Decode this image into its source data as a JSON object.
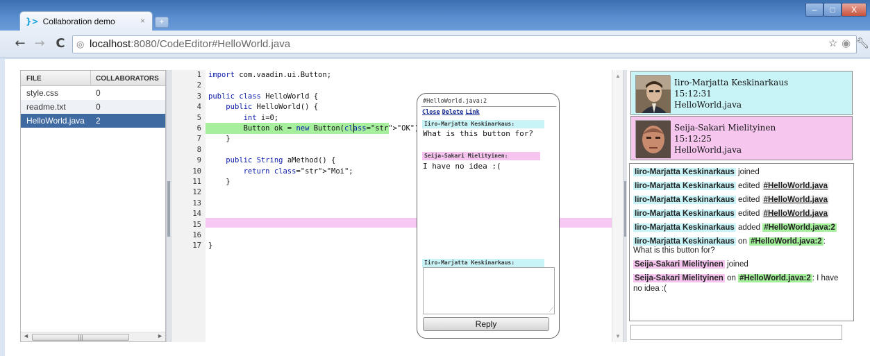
{
  "browser": {
    "tab_title": "Collaboration demo",
    "tab_close": "×",
    "favicon": "}>",
    "new_tab": "+",
    "window_minimize": "–",
    "window_maximize": "□",
    "window_close": "X",
    "url_host": "localhost",
    "url_path": ":8080/CodeEditor#HelloWorld.java"
  },
  "files": {
    "headers": [
      "FILE",
      "COLLABORATORS"
    ],
    "rows": [
      {
        "name": "style.css",
        "count": "0"
      },
      {
        "name": "readme.txt",
        "count": "0"
      },
      {
        "name": "HelloWorld.java",
        "count": "2"
      }
    ],
    "selected_index": 2
  },
  "editor": {
    "lines": [
      "import com.vaadin.ui.Button;",
      "",
      "public class HelloWorld {",
      "    public HelloWorld() {",
      "        int i=0;",
      "        Button ok = new Button(\"OK\");",
      "    }",
      "",
      "    public String aMethod() {",
      "        return \"Moi\";",
      "    }",
      "",
      "",
      "",
      "",
      "",
      "}"
    ],
    "line_numbers": [
      "1",
      "2",
      "3",
      "4",
      "5",
      "6",
      "7",
      "8",
      "9",
      "10",
      "11",
      "12",
      "13",
      "14",
      "15",
      "16",
      "17"
    ],
    "highlight_colors": {
      "own": "#a6ef9d",
      "other": "#f7c9f2"
    }
  },
  "comment_popup": {
    "title": "#HelloWorld.java:2",
    "links": [
      "Close",
      "Delete",
      "Link"
    ],
    "thread": [
      {
        "author": "Iiro-Marjatta Keskinarkaus:",
        "message": "What is this button for?",
        "color": "cyan"
      },
      {
        "author": "Seija-Sakari Mielityinen:",
        "message": "I have no idea :(",
        "color": "pink"
      }
    ],
    "reply_author": "Iiro-Marjatta Keskinarkaus:",
    "reply_button": "Reply"
  },
  "users": [
    {
      "name": "Iiro-Marjatta Keskinarkaus",
      "time": "15:12:31",
      "file": "HelloWorld.java",
      "color": "#c9f4f7"
    },
    {
      "name": "Seija-Sakari Mielityinen",
      "time": "15:12:25",
      "file": "HelloWorld.java",
      "color": "#f6c6ef"
    }
  ],
  "activity": {
    "user1": "Iiro-Marjatta Keskinarkaus",
    "user2": "Seija-Sakari Mielityinen",
    "joined": "joined",
    "edited": "edited",
    "added": "added",
    "on": "on",
    "file_link": "#HelloWorld.java",
    "comment_link": "#HelloWorld.java:2",
    "colon": ":",
    "msg1": "What is this button for?",
    "msg2": ": I have no idea :("
  }
}
